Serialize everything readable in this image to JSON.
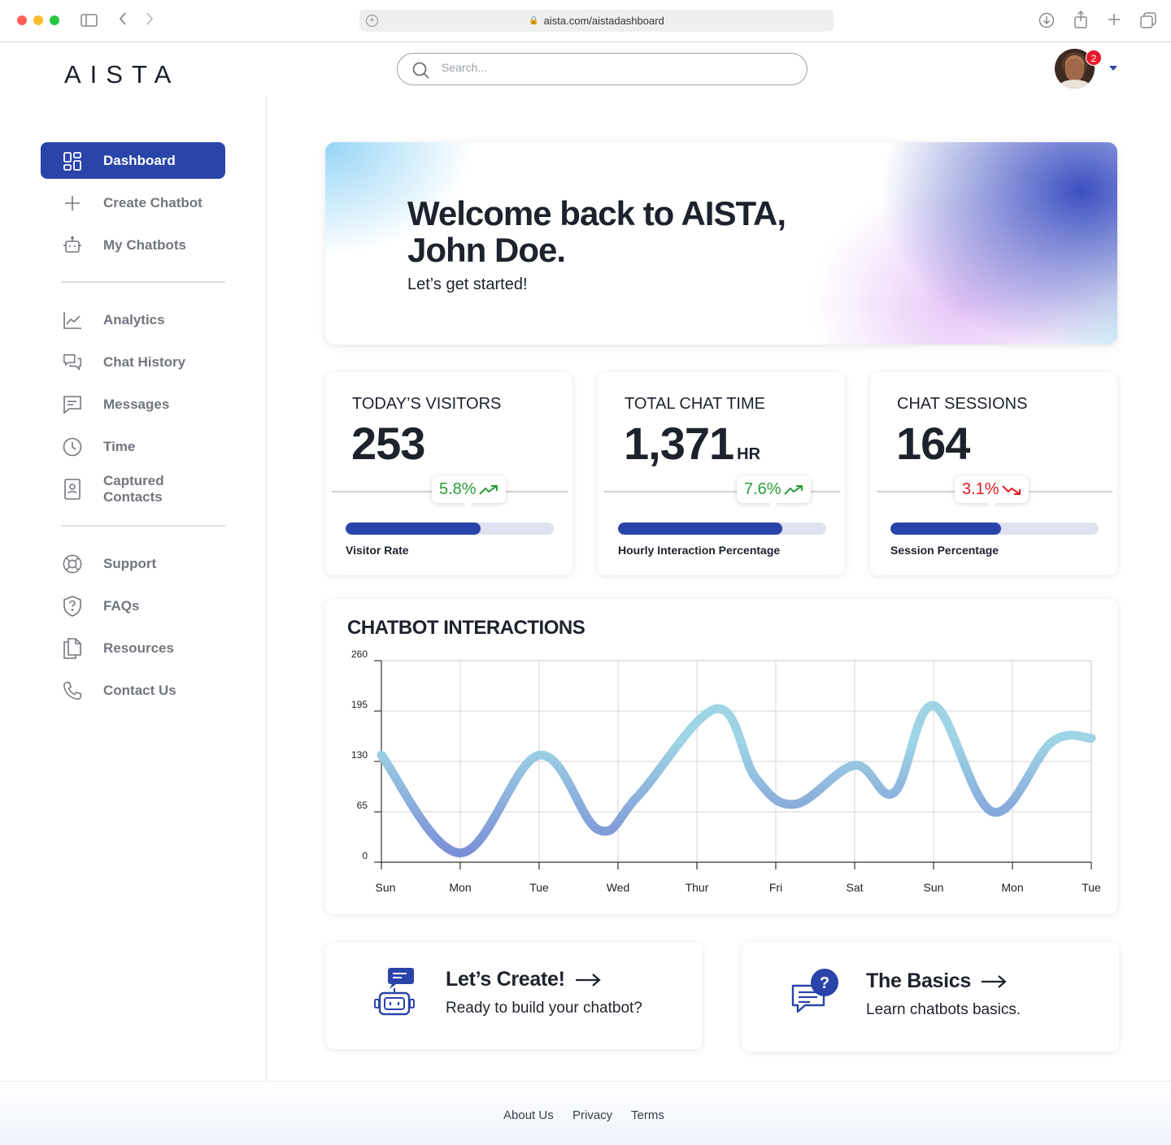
{
  "browser": {
    "url": "aista.com/aistadashboard"
  },
  "header": {
    "logo": "AISTA",
    "search_placeholder": "Search...",
    "notification_count": "2"
  },
  "sidebar": {
    "items": [
      {
        "label": "Dashboard",
        "icon": "grid-icon",
        "active": true
      },
      {
        "label": "Create Chatbot",
        "icon": "plus-icon"
      },
      {
        "label": "My Chatbots",
        "icon": "robot-icon"
      },
      {
        "label": "Analytics",
        "icon": "line-chart-icon"
      },
      {
        "label": "Chat History",
        "icon": "chat-bubbles-icon"
      },
      {
        "label": "Messages",
        "icon": "message-icon"
      },
      {
        "label": "Time",
        "icon": "clock-icon"
      },
      {
        "label": "Captured Contacts",
        "icon": "contact-book-icon"
      },
      {
        "label": "Support",
        "icon": "lifebuoy-icon"
      },
      {
        "label": "FAQs",
        "icon": "shield-question-icon"
      },
      {
        "label": "Resources",
        "icon": "documents-icon"
      },
      {
        "label": "Contact Us",
        "icon": "phone-icon"
      }
    ]
  },
  "hero": {
    "title": "Welcome back to AISTA, John Doe.",
    "subtitle": "Let’s get started!"
  },
  "stats": [
    {
      "label": "TODAY’S VISITORS",
      "value": "253",
      "unit": "",
      "trend": "5.8%",
      "direction": "up",
      "bar_label": "Visitor Rate",
      "bar_fraction": 0.65
    },
    {
      "label": "TOTAL CHAT TIME",
      "value": "1,371",
      "unit": "HR",
      "trend": "7.6%",
      "direction": "up",
      "bar_label": "Hourly Interaction Percentage",
      "bar_fraction": 0.79
    },
    {
      "label": "CHAT SESSIONS",
      "value": "164",
      "unit": "",
      "trend": "3.1%",
      "direction": "down",
      "bar_label": "Session Percentage",
      "bar_fraction": 0.53
    }
  ],
  "colors": {
    "accent": "#2a44a9",
    "trend_up": "#2a9d3a",
    "trend_down": "#e01b24",
    "line_start": "#7b8fd6",
    "line_end": "#9ed4e4"
  },
  "chart_data": {
    "type": "line",
    "title": "CHATBOT INTERACTIONS",
    "categories": [
      "Sun",
      "Mon",
      "Tue",
      "Wed",
      "Thur",
      "Fri",
      "Sat",
      "Sun",
      "Mon",
      "Tue"
    ],
    "y_ticks": [
      0,
      65,
      130,
      195,
      260
    ],
    "ylim": [
      0,
      260
    ],
    "grid": true,
    "curve_x": [
      0,
      1,
      2,
      2.75,
      3.25,
      4.25,
      4.75,
      5.25,
      6.0,
      6.5,
      7.0,
      7.75,
      8.5,
      9.0
    ],
    "curve_y": [
      138,
      12,
      138,
      42,
      85,
      198,
      108,
      75,
      125,
      90,
      202,
      65,
      155,
      160
    ]
  },
  "cta": [
    {
      "title": "Let’s Create!",
      "subtitle": "Ready to build your chatbot?",
      "icon": "robot-chat-icon"
    },
    {
      "title": "The Basics",
      "subtitle": "Learn chatbots basics.",
      "icon": "question-chat-icon"
    }
  ],
  "footer": {
    "links": [
      "About Us",
      "Privacy",
      "Terms"
    ]
  }
}
